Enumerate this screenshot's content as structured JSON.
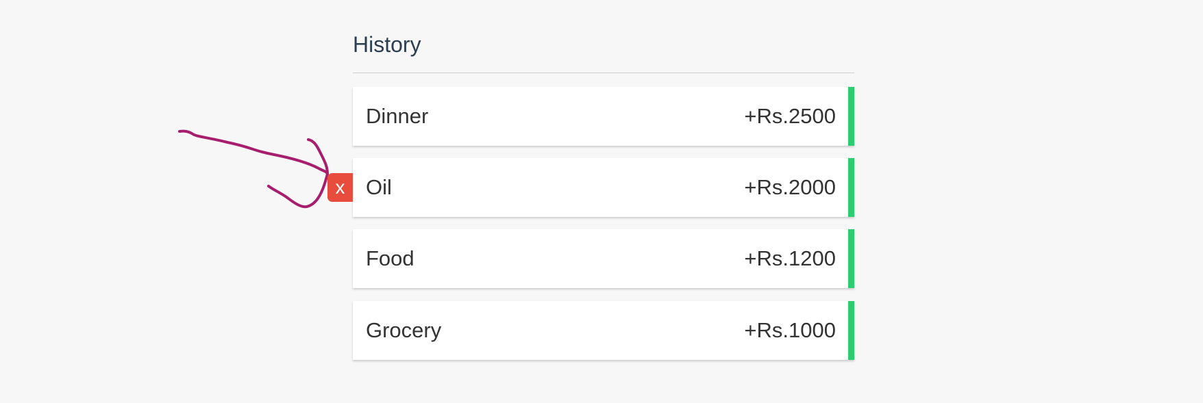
{
  "history": {
    "title": "History",
    "transactions": [
      {
        "label": "Dinner",
        "amount": "+Rs.2500"
      },
      {
        "label": "Oil",
        "amount": "+Rs.2000",
        "delete_label": "x"
      },
      {
        "label": "Food",
        "amount": "+Rs.1200"
      },
      {
        "label": "Grocery",
        "amount": "+Rs.1000"
      }
    ]
  },
  "colors": {
    "income_accent": "#2ecc71",
    "delete_button": "#e74c3c",
    "annotation_stroke": "#a61e6d",
    "background": "#f7f7f7"
  },
  "icons": {
    "annotation": "hand-drawn-arrow-icon"
  }
}
